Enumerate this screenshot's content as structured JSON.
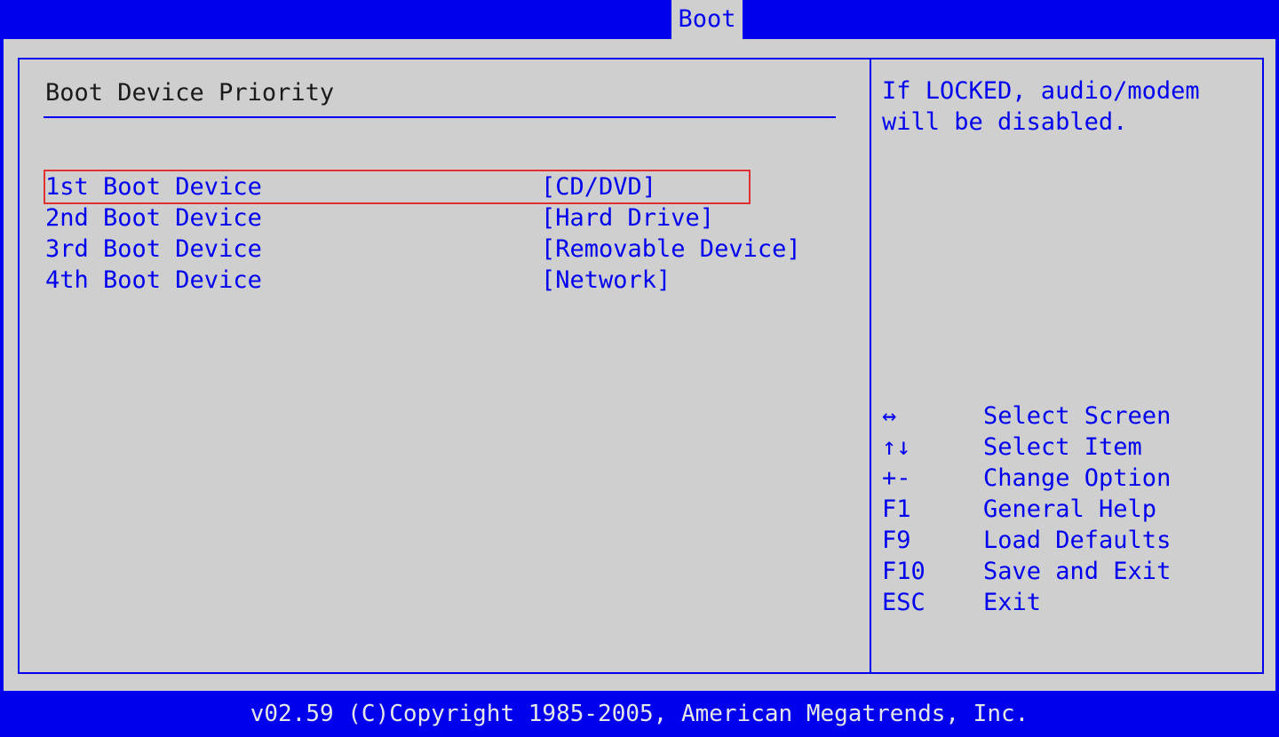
{
  "tabs": [
    {
      "label": "Boot",
      "active": true
    }
  ],
  "section": {
    "title": "Boot Device Priority"
  },
  "devices": [
    {
      "label": "1st Boot Device",
      "value": "[CD/DVD]",
      "highlighted": true
    },
    {
      "label": "2nd Boot Device",
      "value": "[Hard Drive]"
    },
    {
      "label": "3rd Boot Device",
      "value": "[Removable Device]"
    },
    {
      "label": "4th Boot Device",
      "value": "[Network]"
    }
  ],
  "help": {
    "text": "If LOCKED, audio/modem\nwill be disabled."
  },
  "keys": [
    {
      "key": "↔",
      "desc": "Select Screen"
    },
    {
      "key": "↑↓",
      "desc": "Select Item"
    },
    {
      "key": "+-",
      "desc": "Change Option"
    },
    {
      "key": "F1",
      "desc": "General Help"
    },
    {
      "key": "F9",
      "desc": "Load Defaults"
    },
    {
      "key": "F10",
      "desc": "Save and Exit"
    },
    {
      "key": "ESC",
      "desc": "Exit"
    }
  ],
  "footer": {
    "text": "v02.59 (C)Copyright 1985-2005, American Megatrends, Inc."
  },
  "colors": {
    "background_blue": "#0000ee",
    "panel_gray": "#cfcfcf",
    "highlight_outline": "#e03030",
    "footer_text": "#e6e6e6"
  }
}
